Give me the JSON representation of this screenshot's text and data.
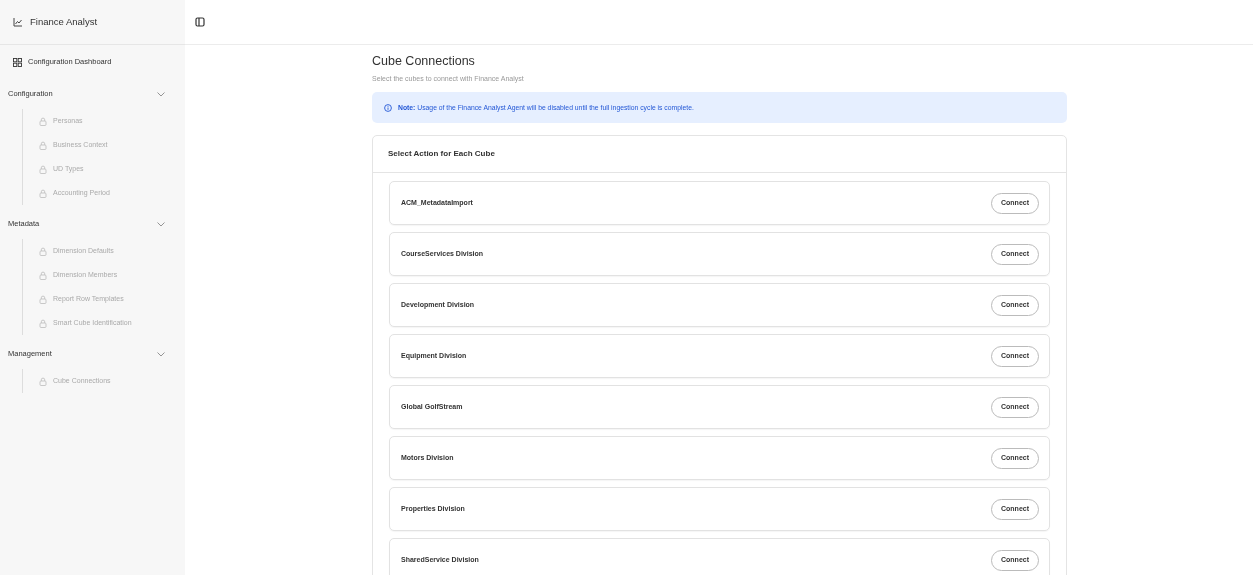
{
  "app": {
    "title": "Finance Analyst"
  },
  "sidebar": {
    "dashboard": "Configuration Dashboard",
    "groups": [
      {
        "label": "Configuration",
        "expanded": true,
        "items": [
          {
            "label": "Personas",
            "disabled": true
          },
          {
            "label": "Business Context",
            "disabled": true
          },
          {
            "label": "UD Types",
            "disabled": true
          },
          {
            "label": "Accounting Period",
            "disabled": true
          }
        ]
      },
      {
        "label": "Metadata",
        "expanded": true,
        "items": [
          {
            "label": "Dimension Defaults",
            "disabled": true
          },
          {
            "label": "Dimension Members",
            "disabled": true
          },
          {
            "label": "Report Row Templates",
            "disabled": true
          },
          {
            "label": "Smart Cube Identification",
            "disabled": true
          }
        ]
      },
      {
        "label": "Management",
        "expanded": true,
        "items": [
          {
            "label": "Cube Connections",
            "disabled": true
          }
        ]
      }
    ]
  },
  "page": {
    "title": "Cube Connections",
    "subtitle": "Select the cubes to connect with Finance Analyst",
    "note": "**Note:** Usage of the Finance Analyst Agent will be disabled until the full ingestion cycle is complete."
  },
  "card": {
    "title": "Select Action for Each Cube",
    "cubes": [
      {
        "name": "ACM_MetadataImport",
        "action": "Connect"
      },
      {
        "name": "CourseServices Division",
        "action": "Connect"
      },
      {
        "name": "Development Division",
        "action": "Connect"
      },
      {
        "name": "Equipment Division",
        "action": "Connect"
      },
      {
        "name": "Global GolfStream",
        "action": "Connect"
      },
      {
        "name": "Motors Division",
        "action": "Connect"
      },
      {
        "name": "Properties Division",
        "action": "Connect"
      },
      {
        "name": "SharedService Division",
        "action": "Connect"
      }
    ]
  }
}
